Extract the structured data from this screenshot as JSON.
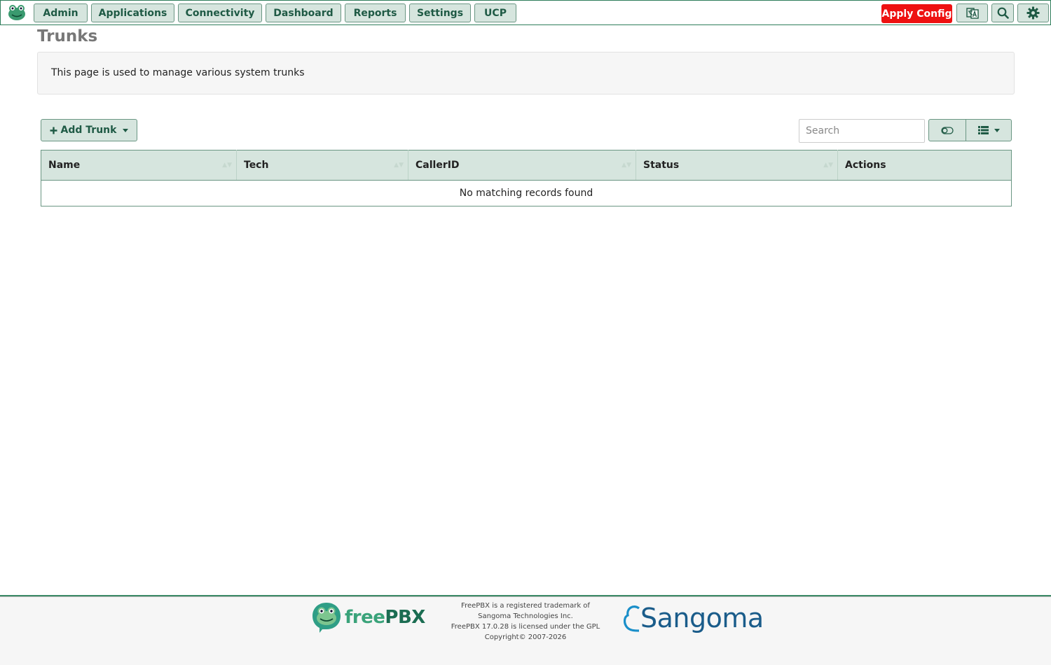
{
  "nav": {
    "items": [
      "Admin",
      "Applications",
      "Connectivity",
      "Dashboard",
      "Reports",
      "Settings",
      "UCP"
    ],
    "apply_label": "Apply Config",
    "icons": [
      "language-icon",
      "search-icon",
      "gear-icon"
    ]
  },
  "page": {
    "title": "Trunks",
    "description": "This page is used to manage various system trunks"
  },
  "toolbar": {
    "add_label": "Add Trunk",
    "search_placeholder": "Search"
  },
  "table": {
    "columns": [
      "Name",
      "Tech",
      "CallerID",
      "Status",
      "Actions"
    ],
    "empty_message": "No matching records found"
  },
  "footer": {
    "freepbx_logo_free": "free",
    "freepbx_logo_pbx": "PBX",
    "legal": [
      "FreePBX is a registered trademark of",
      "Sangoma Technologies Inc.",
      "FreePBX 17.0.28 is licensed under the GPL",
      "Copyright© 2007-2026"
    ],
    "sangoma_logo": "Sangoma"
  },
  "colors": {
    "accent": "#d6e5de",
    "accent_border": "#6a9683",
    "accent_text": "#1f5a45",
    "apply": "#ee1111"
  }
}
